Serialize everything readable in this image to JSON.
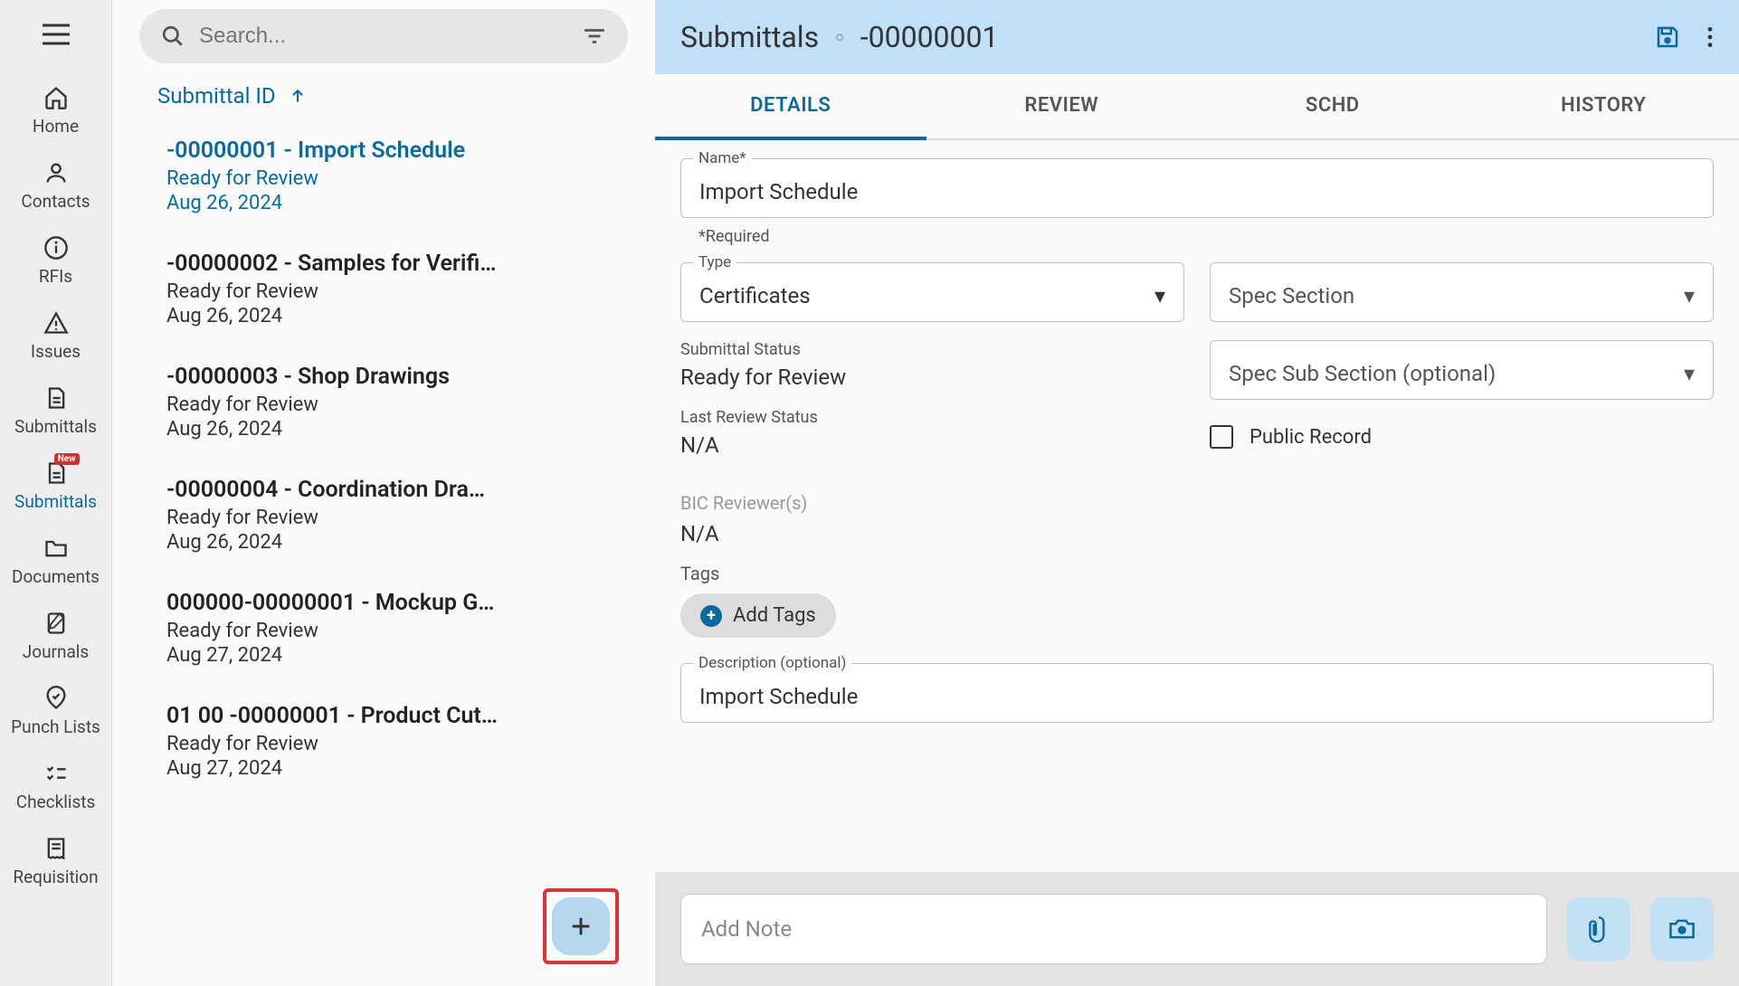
{
  "sidebar": {
    "items": [
      {
        "label": "Home"
      },
      {
        "label": "Contacts"
      },
      {
        "label": "RFIs"
      },
      {
        "label": "Issues"
      },
      {
        "label": "Submittals"
      },
      {
        "label": "Submittals",
        "badge": "New"
      },
      {
        "label": "Documents"
      },
      {
        "label": "Journals"
      },
      {
        "label": "Punch Lists"
      },
      {
        "label": "Checklists"
      },
      {
        "label": "Requisition"
      }
    ]
  },
  "search": {
    "placeholder": "Search..."
  },
  "sort": {
    "label": "Submittal ID"
  },
  "list": [
    {
      "title": "-00000001 -  Import Schedule",
      "status": "Ready for Review",
      "date": "Aug 26, 2024"
    },
    {
      "title": "-00000002 -  Samples for Verifi…",
      "status": "Ready for Review",
      "date": "Aug 26, 2024"
    },
    {
      "title": "-00000003 -  Shop Drawings",
      "status": "Ready for Review",
      "date": "Aug 26, 2024"
    },
    {
      "title": "-00000004 -  Coordination Dra…",
      "status": "Ready for Review",
      "date": "Aug 26, 2024"
    },
    {
      "title": "000000-00000001 -  Mockup G…",
      "status": "Ready for Review",
      "date": "Aug 27, 2024"
    },
    {
      "title": "01 00 -00000001 -  Product Cut…",
      "status": "Ready for Review",
      "date": "Aug 27, 2024"
    }
  ],
  "header": {
    "title": "Submittals",
    "id": "-00000001"
  },
  "tabs": {
    "t0": "DETAILS",
    "t1": "REVIEW",
    "t2": "SCHD",
    "t3": "HISTORY"
  },
  "form": {
    "name_label": "Name*",
    "name_value": "Import Schedule",
    "required_note": "*Required",
    "type_label": "Type",
    "type_value": "Certificates",
    "spec_section_placeholder": "Spec Section",
    "status_label": "Submittal Status",
    "status_value": "Ready for Review",
    "spec_sub_placeholder": "Spec Sub Section (optional)",
    "last_review_label": "Last Review Status",
    "last_review_value": "N/A",
    "public_record_label": "Public Record",
    "bic_label": "BIC Reviewer(s)",
    "bic_value": "N/A",
    "tags_label": "Tags",
    "add_tags_label": "Add Tags",
    "desc_label": "Description (optional)",
    "desc_value": "Import Schedule",
    "add_note_placeholder": "Add Note"
  }
}
